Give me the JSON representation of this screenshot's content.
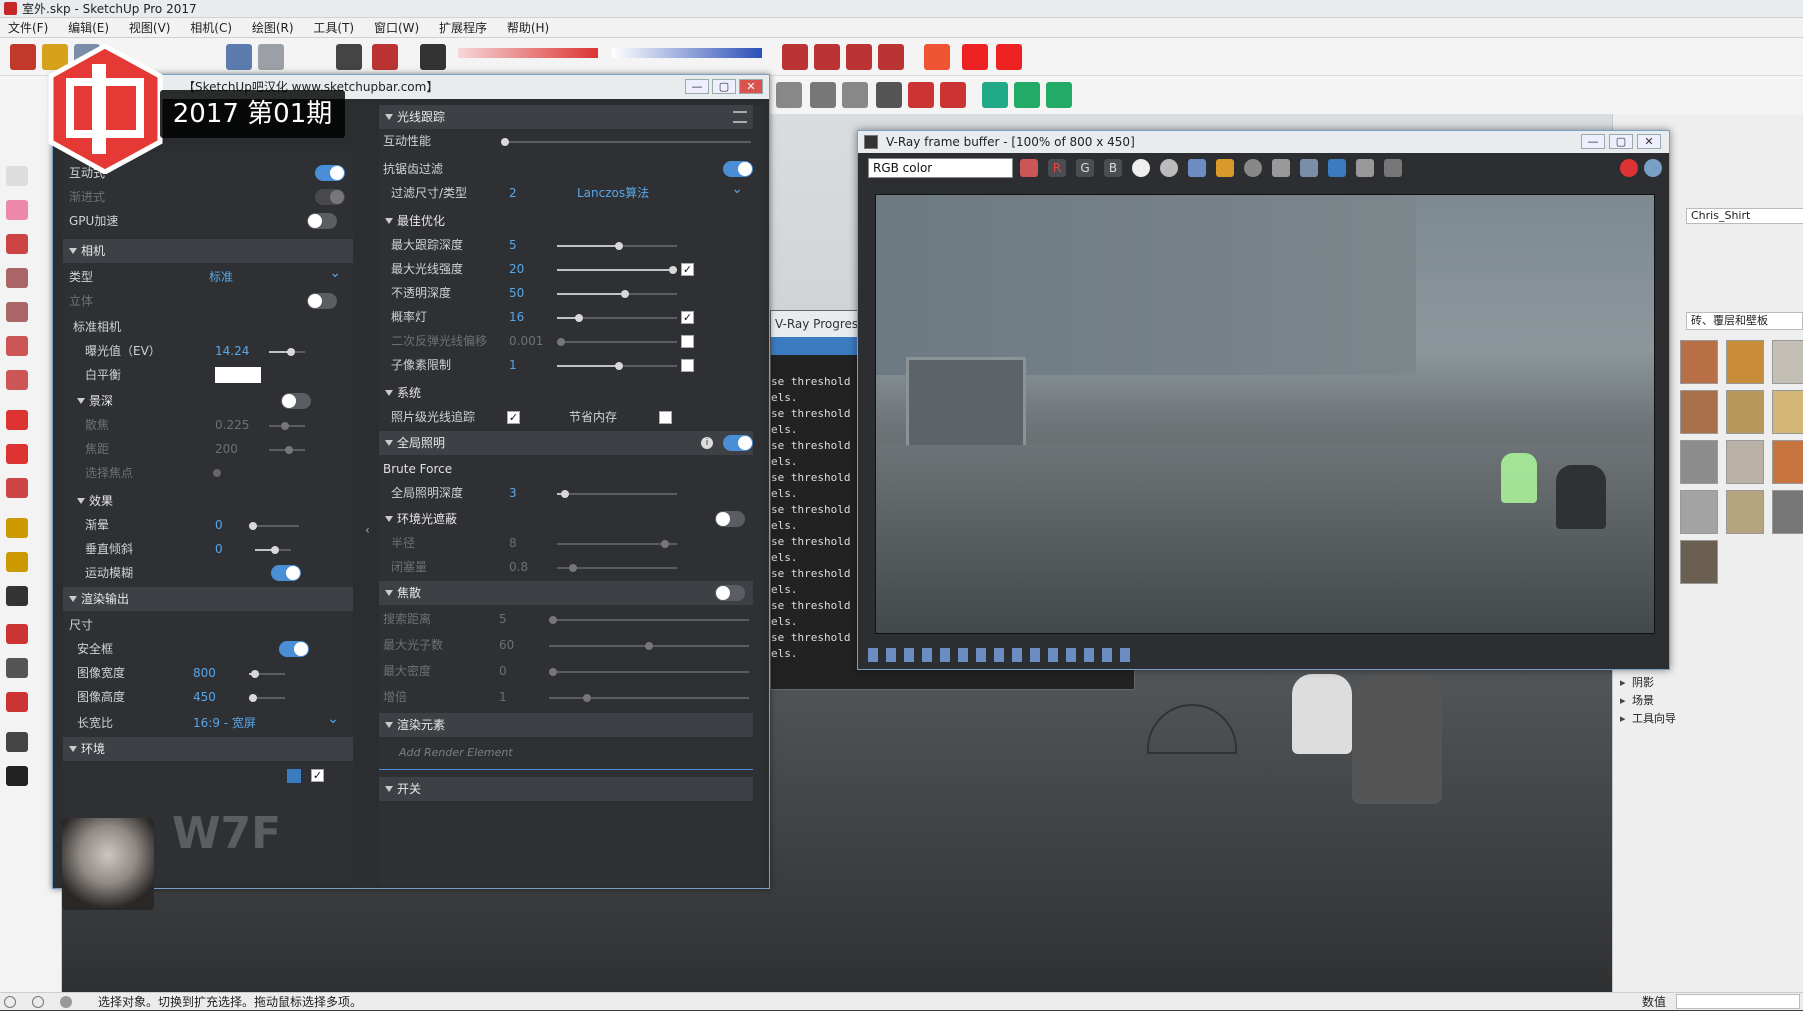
{
  "app": {
    "title": "室外.skp - SketchUp Pro 2017",
    "menu": [
      "文件(F)",
      "编辑(E)",
      "视图(V)",
      "相机(C)",
      "绘图(R)",
      "工具(T)",
      "窗口(W)",
      "扩展程序",
      "帮助(H)"
    ],
    "status_text": "选择对象。切换到扩充选择。拖动鼠标选择多项。",
    "status_right": "数值"
  },
  "overlay": {
    "banner": "2017 第01期",
    "watermark": "W7F"
  },
  "vray_editor": {
    "window_title": "【SketchUp吧汉化 www.sketchupbar.com】",
    "left": {
      "interactive_label": "互动式",
      "progressive_label": "渐进式",
      "gpu_label": "GPU加速",
      "camera_section": "相机",
      "type_label": "类型",
      "type_value": "标准",
      "stereo_label": "立体",
      "std_camera_label": "标准相机",
      "ev_label": "曝光值（EV）",
      "ev_value": "14.24",
      "wb_label": "白平衡",
      "dof_label": "景深",
      "defocus_label": "散焦",
      "defocus_value": "0.225",
      "focus_label": "焦距",
      "focus_value": "200",
      "pick_focus_label": "选择焦点",
      "effects_label": "效果",
      "vignette_label": "渐晕",
      "vignette_value": "0",
      "vtilt_label": "垂直倾斜",
      "vtilt_value": "0",
      "motion_blur_label": "运动模糊",
      "render_output_section": "渲染输出",
      "size_label": "尺寸",
      "safe_frame_label": "安全框",
      "width_label": "图像宽度",
      "width_value": "800",
      "height_label": "图像高度",
      "height_value": "450",
      "aspect_label": "长宽比",
      "aspect_value": "16:9 - 宽屏",
      "env_label": "环境"
    },
    "right": {
      "raytrace_section": "光线跟踪",
      "interactive_perf_label": "互动性能",
      "aa_label": "抗锯齿过滤",
      "filter_label": "过滤尺寸/类型",
      "filter_size": "2",
      "filter_type": "Lanczos算法",
      "optimization_section": "最佳优化",
      "max_trace_depth_label": "最大跟踪深度",
      "max_trace_depth": "5",
      "max_ray_intensity_label": "最大光线强度",
      "max_ray_intensity": "20",
      "opacity_depth_label": "不透明深度",
      "opacity_depth": "50",
      "prob_lights_label": "概率灯",
      "prob_lights": "16",
      "secondary_bias_label": "二次反弹光线偏移",
      "secondary_bias": "0.001",
      "subdiv_limit_label": "子像素限制",
      "subdiv_limit": "1",
      "system_section": "系统",
      "photon_label": "照片级光线追踪",
      "save_memory_label": "节省内存",
      "gi_section": "全局照明",
      "brute_force_label": "Brute Force",
      "gi_depth_label": "全局照明深度",
      "gi_depth": "3",
      "ao_section": "环境光遮蔽",
      "radius_label": "半径",
      "radius_value": "8",
      "occlusion_label": "闭塞量",
      "occlusion_value": "0.8",
      "caustics_section": "焦散",
      "search_dist_label": "搜索距离",
      "search_dist": "5",
      "max_photons_label": "最大光子数",
      "max_photons": "60",
      "max_density_label": "最大密度",
      "max_density": "0",
      "multiplier_label": "增倍",
      "multiplier": "1",
      "render_elements_section": "渲染元素",
      "add_render_element": "Add Render Element",
      "switches_section": "开关"
    }
  },
  "frame_buffer": {
    "title": "V-Ray frame buffer - [100% of 800 x 450]",
    "channel": "RGB color",
    "r_label": "R",
    "g_label": "G",
    "b_label": "B"
  },
  "progress": {
    "title": "V-Ray Progress",
    "lines": [
      "se threshold lo",
      "els.",
      "se threshold lo",
      "els.",
      "se threshold lo",
      "els.",
      "se threshold lo",
      "els.",
      "se threshold lo",
      "els.",
      "se threshold lo",
      "els.",
      "se threshold lo",
      "els.",
      "se threshold lo",
      "els.",
      "se threshold lo",
      "els."
    ]
  },
  "right_panel": {
    "input_value": "Chris_Shirt",
    "materials_select": "砖、覆层和壁板",
    "tree": [
      "阴影",
      "场景",
      "工具向导"
    ]
  }
}
